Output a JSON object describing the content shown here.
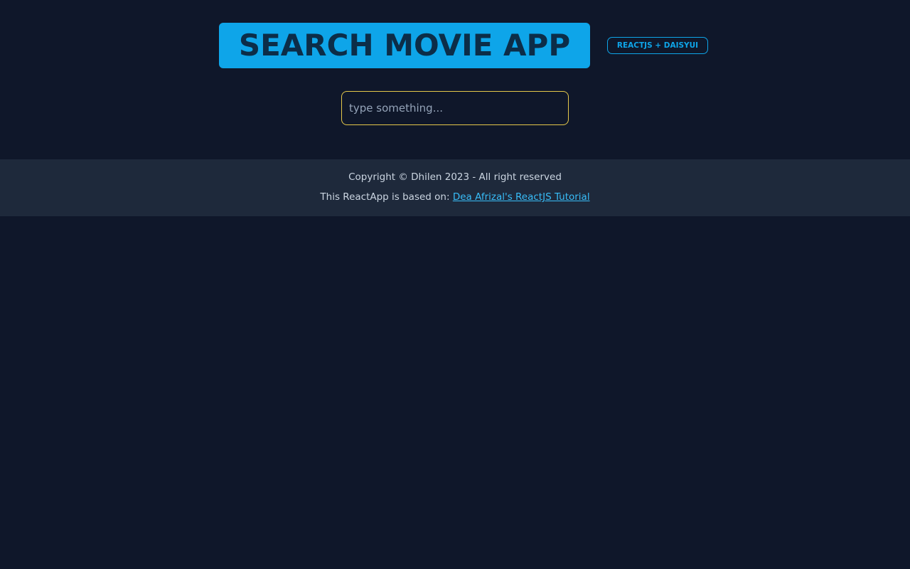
{
  "header": {
    "title": "SEARCH MOVIE APP",
    "badge": "REACTJS + DAISYUI"
  },
  "search": {
    "placeholder": "type something...",
    "value": ""
  },
  "footer": {
    "copyright": "Copyright © Dhilen 2023 - All right reserved",
    "based_on_prefix": "This ReactApp is based on: ",
    "based_on_link": "Dea Afrizal's ReactJS Tutorial"
  },
  "colors": {
    "background": "#0f172a",
    "footer_background": "#1e293b",
    "primary": "#0ea5e9",
    "title_text": "#0c2d48",
    "input_border": "#e5c84a",
    "link": "#38bdf8"
  }
}
